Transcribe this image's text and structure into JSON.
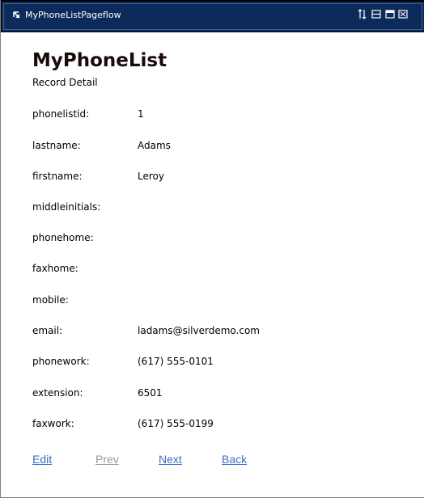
{
  "window": {
    "title": "MyPhoneListPageflow",
    "collapse_icon": "collapse-arrow-icon",
    "controls": [
      "move-icon",
      "minimize-icon",
      "maximize-icon",
      "close-icon"
    ]
  },
  "page": {
    "title": "MyPhoneList",
    "subtitle": "Record Detail"
  },
  "record": {
    "fields": [
      {
        "label": "phonelistid:",
        "value": "1"
      },
      {
        "label": "lastname:",
        "value": "Adams"
      },
      {
        "label": "firstname:",
        "value": "Leroy"
      },
      {
        "label": "middleinitials:",
        "value": ""
      },
      {
        "label": "phonehome:",
        "value": ""
      },
      {
        "label": "faxhome:",
        "value": ""
      },
      {
        "label": "mobile:",
        "value": ""
      },
      {
        "label": "email:",
        "value": "ladams@silverdemo.com"
      },
      {
        "label": "phonework:",
        "value": "(617) 555-0101"
      },
      {
        "label": "extension:",
        "value": "6501"
      },
      {
        "label": "faxwork:",
        "value": "(617) 555-0199"
      }
    ]
  },
  "nav": {
    "edit": "Edit",
    "prev": "Prev",
    "next": "Next",
    "back": "Back"
  },
  "colors": {
    "titlebar": "#0c2a5a",
    "link": "#3a6fc4",
    "link_disabled": "#9a9e9a"
  }
}
